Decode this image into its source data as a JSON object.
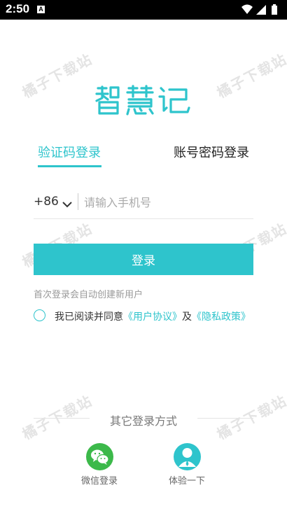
{
  "status_bar": {
    "time": "2:50",
    "notification_badge": "A"
  },
  "watermark_text": "橘子下载站",
  "app": {
    "logo_text": "智慧记",
    "brand_color": "#2ec4cc"
  },
  "tabs": [
    {
      "label": "验证码登录",
      "active": true
    },
    {
      "label": "账号密码登录",
      "active": false
    }
  ],
  "phone": {
    "country_code": "+86",
    "placeholder": "请输入手机号",
    "value": ""
  },
  "login_button": {
    "label": "登录"
  },
  "hint": "首次登录会自动创建新用户",
  "agreement": {
    "checked": false,
    "prefix": "我已阅读并同意",
    "user_agreement": "《用户协议》",
    "conjunction": "及",
    "privacy_policy": "《隐私政策》"
  },
  "other_login": {
    "title": "其它登录方式",
    "options": [
      {
        "label": "微信登录",
        "icon": "wechat-icon",
        "color": "#3cb94a"
      },
      {
        "label": "体验一下",
        "icon": "person-icon",
        "color": "#2ec4cc"
      }
    ]
  }
}
